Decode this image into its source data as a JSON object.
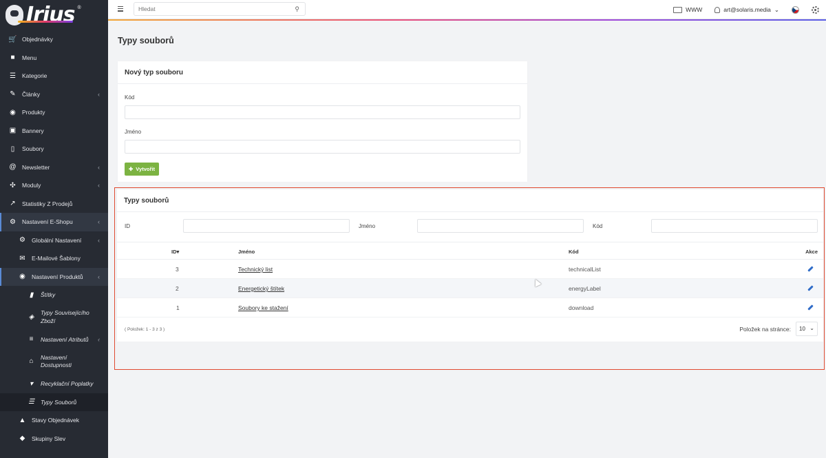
{
  "brand": {
    "name": "Irius",
    "reg": "®"
  },
  "topbar": {
    "search_placeholder": "Hledat",
    "www_label": "WWW",
    "user_email": "art@solaris.media"
  },
  "sidebar": {
    "items": [
      {
        "label": "Objednávky",
        "icon": "cart-icon"
      },
      {
        "label": "Menu",
        "icon": "folder-icon"
      },
      {
        "label": "Kategorie",
        "icon": "list-icon"
      },
      {
        "label": "Články",
        "icon": "pencil-icon",
        "chevron": true
      },
      {
        "label": "Produkty",
        "icon": "globe-icon"
      },
      {
        "label": "Bannery",
        "icon": "image-icon"
      },
      {
        "label": "Soubory",
        "icon": "file-icon"
      },
      {
        "label": "Newsletter",
        "icon": "at-icon",
        "chevron": true
      },
      {
        "label": "Moduly",
        "icon": "puzzle-icon",
        "chevron": true
      },
      {
        "label": "Statistiky Z Prodejů",
        "icon": "chart-icon"
      },
      {
        "label": "Nastavení E-Shopu",
        "icon": "cogs-icon",
        "chevron": true
      }
    ],
    "sub_items": [
      {
        "label": "Globální Nastavení",
        "icon": "gear-icon",
        "chevron": true
      },
      {
        "label": "E-Mailové Šablony",
        "icon": "mail-icon"
      },
      {
        "label": "Nastavení Produktů",
        "icon": "globe-icon",
        "chevron": true
      }
    ],
    "sub2_items": [
      {
        "label": "Štítky",
        "icon": "bookmark-icon"
      },
      {
        "label": "Typy Souvisejícího Zboží",
        "icon": "layers-icon"
      },
      {
        "label": "Nastavení Atributů",
        "icon": "sliders-icon",
        "chevron": true
      },
      {
        "label": "Nastavení Dostupnosti",
        "icon": "home-icon"
      },
      {
        "label": "Recyklační Poplatky",
        "icon": "trash-icon"
      },
      {
        "label": "Typy Souborů",
        "icon": "list-icon"
      }
    ],
    "bottom_items": [
      {
        "label": "Stavy Objednávek",
        "icon": "bell-icon"
      },
      {
        "label": "Skupiny Slev",
        "icon": "tag-icon"
      }
    ]
  },
  "page": {
    "title": "Typy souborů"
  },
  "form": {
    "title": "Nový typ souboru",
    "code_label": "Kód",
    "name_label": "Jméno",
    "create_button": "Vytvořit"
  },
  "table": {
    "title": "Typy souborů",
    "filter_id": "ID",
    "filter_name": "Jméno",
    "filter_code": "Kód",
    "col_id": "ID",
    "col_name": "Jméno",
    "col_code": "Kód",
    "col_actions": "Akce",
    "rows": [
      {
        "id": "3",
        "name": "Technický list",
        "code": "technicalList"
      },
      {
        "id": "2",
        "name": "Energetický štítek",
        "code": "energyLabel"
      },
      {
        "id": "1",
        "name": "Soubory ke stažení",
        "code": "download"
      }
    ],
    "count_text": "( Položek: 1 - 3 z 3 )",
    "per_page_label": "Položek na stránce:",
    "per_page_value": "10"
  },
  "colors": {
    "sidebar_bg": "#272b33",
    "accent_green": "#7cb342",
    "highlight": "#e0492f",
    "link_blue": "#2f6cc8"
  }
}
